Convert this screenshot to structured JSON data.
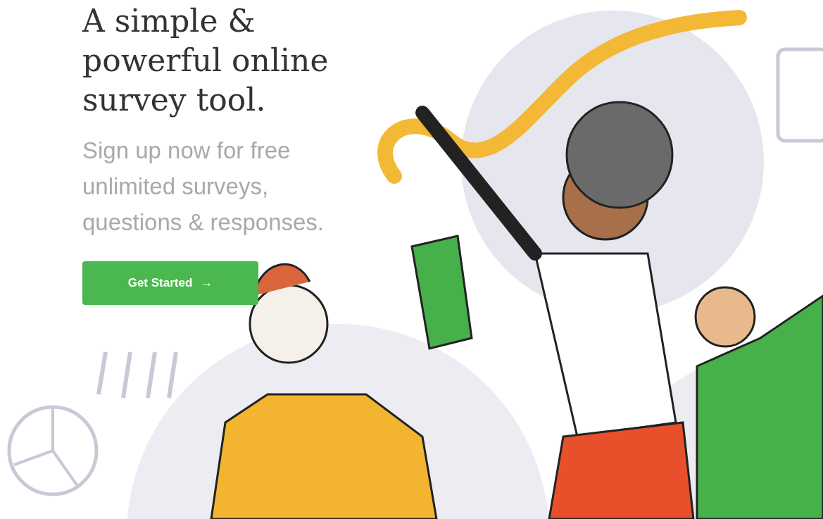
{
  "hero": {
    "heading": "A simple & powerful online survey tool.",
    "subheading": "Sign up now for free unlimited surveys, questions & responses.",
    "button": {
      "label": "Get Started",
      "icon": "→"
    }
  }
}
